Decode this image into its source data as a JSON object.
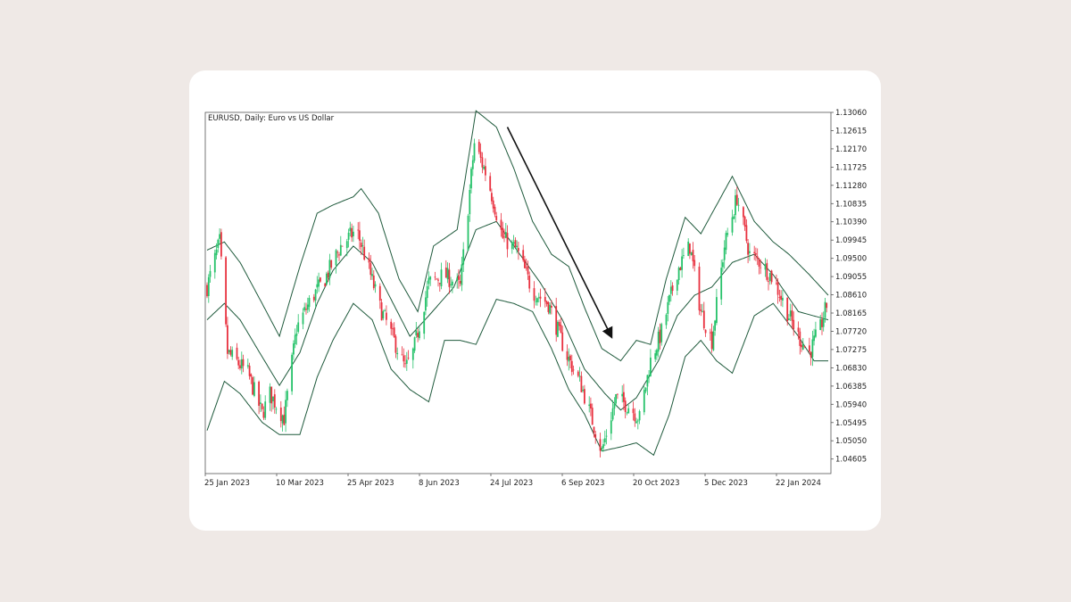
{
  "colors": {
    "background": "#efe9e6",
    "card": "#ffffff",
    "bull": "#26c26a",
    "bear": "#e8313f",
    "band": "#1f5a3c",
    "arrow": "#111111"
  },
  "chart_data": {
    "type": "candlestick",
    "title": "EURUSD, Daily:  Euro vs US Dollar",
    "indicator": "Bollinger Bands",
    "ylim": [
      1.0425,
      1.1306
    ],
    "yticks": [
      "1.13060",
      "1.12615",
      "1.12170",
      "1.11725",
      "1.11280",
      "1.10835",
      "1.10390",
      "1.09945",
      "1.09500",
      "1.09055",
      "1.08610",
      "1.08165",
      "1.07720",
      "1.07275",
      "1.06830",
      "1.06385",
      "1.05940",
      "1.05495",
      "1.05050",
      "1.04605"
    ],
    "xticks": [
      "25 Jan 2023",
      "10 Mar 2023",
      "25 Apr 2023",
      "8 Jun 2023",
      "24 Jul 2023",
      "6 Sep 2023",
      "20 Oct 2023",
      "5 Dec 2023",
      "22 Jan 2024"
    ],
    "close_path": [
      [
        "2023-01-25",
        1.088
      ],
      [
        "2023-02-02",
        1.099
      ],
      [
        "2023-02-07",
        1.072
      ],
      [
        "2023-02-20",
        1.067
      ],
      [
        "2023-03-01",
        1.057
      ],
      [
        "2023-03-06",
        1.062
      ],
      [
        "2023-03-15",
        1.056
      ],
      [
        "2023-03-23",
        1.078
      ],
      [
        "2023-04-01",
        1.085
      ],
      [
        "2023-04-10",
        1.09
      ],
      [
        "2023-04-20",
        1.098
      ],
      [
        "2023-04-30",
        1.102
      ],
      [
        "2023-05-05",
        1.096
      ],
      [
        "2023-05-15",
        1.083
      ],
      [
        "2023-05-25",
        1.074
      ],
      [
        "2023-05-31",
        1.068
      ],
      [
        "2023-06-05",
        1.072
      ],
      [
        "2023-06-15",
        1.089
      ],
      [
        "2023-06-25",
        1.091
      ],
      [
        "2023-07-05",
        1.088
      ],
      [
        "2023-07-14",
        1.123
      ],
      [
        "2023-07-22",
        1.115
      ],
      [
        "2023-08-01",
        1.1
      ],
      [
        "2023-08-10",
        1.097
      ],
      [
        "2023-08-20",
        1.087
      ],
      [
        "2023-08-30",
        1.084
      ],
      [
        "2023-09-10",
        1.072
      ],
      [
        "2023-09-20",
        1.064
      ],
      [
        "2023-10-03",
        1.048
      ],
      [
        "2023-10-12",
        1.061
      ],
      [
        "2023-10-20",
        1.059
      ],
      [
        "2023-10-27",
        1.056
      ],
      [
        "2023-11-03",
        1.07
      ],
      [
        "2023-11-10",
        1.077
      ],
      [
        "2023-11-20",
        1.092
      ],
      [
        "2023-11-28",
        1.098
      ],
      [
        "2023-12-05",
        1.082
      ],
      [
        "2023-12-12",
        1.075
      ],
      [
        "2023-12-20",
        1.098
      ],
      [
        "2023-12-28",
        1.11
      ],
      [
        "2024-01-05",
        1.096
      ],
      [
        "2024-01-12",
        1.094
      ],
      [
        "2024-01-20",
        1.09
      ],
      [
        "2024-01-30",
        1.081
      ],
      [
        "2024-02-05",
        1.076
      ],
      [
        "2024-02-12",
        1.072
      ],
      [
        "2024-02-19",
        1.078
      ],
      [
        "2024-02-24",
        1.085
      ]
    ],
    "bands": {
      "upper": [
        [
          "2023-01-25",
          1.097
        ],
        [
          "2023-02-05",
          1.099
        ],
        [
          "2023-02-15",
          1.094
        ],
        [
          "2023-03-01",
          1.084
        ],
        [
          "2023-03-12",
          1.076
        ],
        [
          "2023-03-25",
          1.093
        ],
        [
          "2023-04-05",
          1.106
        ],
        [
          "2023-04-15",
          1.108
        ],
        [
          "2023-04-28",
          1.11
        ],
        [
          "2023-05-03",
          1.112
        ],
        [
          "2023-05-14",
          1.106
        ],
        [
          "2023-05-27",
          1.09
        ],
        [
          "2023-06-08",
          1.082
        ],
        [
          "2023-06-18",
          1.098
        ],
        [
          "2023-07-03",
          1.102
        ],
        [
          "2023-07-15",
          1.131
        ],
        [
          "2023-07-28",
          1.127
        ],
        [
          "2023-08-08",
          1.117
        ],
        [
          "2023-08-20",
          1.104
        ],
        [
          "2023-09-01",
          1.096
        ],
        [
          "2023-09-12",
          1.093
        ],
        [
          "2023-09-22",
          1.083
        ],
        [
          "2023-10-03",
          1.073
        ],
        [
          "2023-10-15",
          1.07
        ],
        [
          "2023-10-25",
          1.075
        ],
        [
          "2023-11-03",
          1.074
        ],
        [
          "2023-11-13",
          1.09
        ],
        [
          "2023-11-25",
          1.105
        ],
        [
          "2023-12-05",
          1.101
        ],
        [
          "2023-12-15",
          1.108
        ],
        [
          "2023-12-25",
          1.115
        ],
        [
          "2024-01-08",
          1.104
        ],
        [
          "2024-01-20",
          1.099
        ],
        [
          "2024-01-30",
          1.096
        ],
        [
          "2024-02-12",
          1.091
        ],
        [
          "2024-02-24",
          1.086
        ]
      ],
      "middle": [
        [
          "2023-01-25",
          1.08
        ],
        [
          "2023-02-05",
          1.084
        ],
        [
          "2023-02-15",
          1.08
        ],
        [
          "2023-03-01",
          1.071
        ],
        [
          "2023-03-12",
          1.064
        ],
        [
          "2023-03-25",
          1.072
        ],
        [
          "2023-04-05",
          1.084
        ],
        [
          "2023-04-15",
          1.092
        ],
        [
          "2023-04-28",
          1.098
        ],
        [
          "2023-05-10",
          1.094
        ],
        [
          "2023-05-22",
          1.085
        ],
        [
          "2023-06-03",
          1.076
        ],
        [
          "2023-06-15",
          1.081
        ],
        [
          "2023-07-01",
          1.088
        ],
        [
          "2023-07-15",
          1.102
        ],
        [
          "2023-07-28",
          1.104
        ],
        [
          "2023-08-10",
          1.097
        ],
        [
          "2023-08-25",
          1.089
        ],
        [
          "2023-09-08",
          1.08
        ],
        [
          "2023-09-22",
          1.068
        ],
        [
          "2023-10-05",
          1.062
        ],
        [
          "2023-10-15",
          1.058
        ],
        [
          "2023-10-25",
          1.061
        ],
        [
          "2023-11-08",
          1.07
        ],
        [
          "2023-11-20",
          1.081
        ],
        [
          "2023-12-01",
          1.086
        ],
        [
          "2023-12-12",
          1.088
        ],
        [
          "2023-12-25",
          1.094
        ],
        [
          "2024-01-08",
          1.096
        ],
        [
          "2024-01-20",
          1.091
        ],
        [
          "2024-02-05",
          1.082
        ],
        [
          "2024-02-24",
          1.08
        ]
      ],
      "lower": [
        [
          "2023-01-25",
          1.053
        ],
        [
          "2023-02-05",
          1.065
        ],
        [
          "2023-02-15",
          1.062
        ],
        [
          "2023-03-01",
          1.055
        ],
        [
          "2023-03-12",
          1.052
        ],
        [
          "2023-03-25",
          1.052
        ],
        [
          "2023-04-05",
          1.066
        ],
        [
          "2023-04-15",
          1.075
        ],
        [
          "2023-04-28",
          1.084
        ],
        [
          "2023-05-10",
          1.08
        ],
        [
          "2023-05-22",
          1.068
        ],
        [
          "2023-06-03",
          1.063
        ],
        [
          "2023-06-15",
          1.06
        ],
        [
          "2023-06-25",
          1.075
        ],
        [
          "2023-07-05",
          1.075
        ],
        [
          "2023-07-15",
          1.074
        ],
        [
          "2023-07-28",
          1.085
        ],
        [
          "2023-08-08",
          1.084
        ],
        [
          "2023-08-20",
          1.082
        ],
        [
          "2023-09-01",
          1.073
        ],
        [
          "2023-09-12",
          1.063
        ],
        [
          "2023-09-22",
          1.057
        ],
        [
          "2023-10-03",
          1.048
        ],
        [
          "2023-10-15",
          1.049
        ],
        [
          "2023-10-25",
          1.05
        ],
        [
          "2023-11-05",
          1.047
        ],
        [
          "2023-11-15",
          1.057
        ],
        [
          "2023-11-25",
          1.071
        ],
        [
          "2023-12-05",
          1.075
        ],
        [
          "2023-12-15",
          1.07
        ],
        [
          "2023-12-25",
          1.067
        ],
        [
          "2024-01-08",
          1.081
        ],
        [
          "2024-01-20",
          1.084
        ],
        [
          "2024-02-05",
          1.076
        ],
        [
          "2024-02-15",
          1.07
        ],
        [
          "2024-02-24",
          1.07
        ]
      ]
    },
    "annotation": {
      "type": "arrow",
      "from": [
        "2023-08-04",
        1.127
      ],
      "to": [
        "2023-10-09",
        1.076
      ]
    },
    "grid": false,
    "legend": "none"
  }
}
